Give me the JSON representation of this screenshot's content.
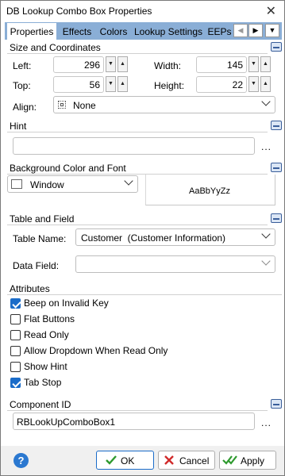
{
  "window": {
    "title": "DB Lookup Combo Box Properties",
    "close_glyph": "✕"
  },
  "tabs": [
    {
      "label": "Properties",
      "active": true
    },
    {
      "label": "Effects"
    },
    {
      "label": "Colors"
    },
    {
      "label": "Lookup Settings"
    },
    {
      "label": "EEPs"
    }
  ],
  "tab_nav": {
    "prev": "◀",
    "next": "▶",
    "menu": "▼"
  },
  "size_coords": {
    "header": "Size and Coordinates",
    "left_label": "Left:",
    "left_value": "296",
    "top_label": "Top:",
    "top_value": "56",
    "width_label": "Width:",
    "width_value": "145",
    "height_label": "Height:",
    "height_value": "22",
    "align_label": "Align:",
    "align_value": "None"
  },
  "spin": {
    "down": "▼",
    "up": "▲"
  },
  "hint": {
    "header": "Hint",
    "value": "",
    "ellipsis": "..."
  },
  "bg_font": {
    "header": "Background Color and Font",
    "color_value": "Window",
    "font_preview": "AaBbYyZz"
  },
  "table_field": {
    "header": "Table and Field",
    "table_label": "Table Name:",
    "table_value": "Customer  (Customer Information)",
    "field_label": "Data Field:",
    "field_value": ""
  },
  "attributes": {
    "header": "Attributes",
    "items": [
      {
        "label": "Beep on Invalid Key",
        "checked": true
      },
      {
        "label": "Flat Buttons",
        "checked": false
      },
      {
        "label": "Read Only",
        "checked": false
      },
      {
        "label": "Allow Dropdown When Read Only",
        "checked": false
      },
      {
        "label": "Show Hint",
        "checked": false
      },
      {
        "label": "Tab Stop",
        "checked": true
      }
    ]
  },
  "component_id": {
    "header": "Component ID",
    "value": "RBLookUpComboBox1",
    "ellipsis": "..."
  },
  "footer": {
    "help": "?",
    "ok_label": "OK",
    "cancel_label": "Cancel",
    "apply_label": "Apply"
  },
  "colors": {
    "tab_bar": "#8aaed6",
    "accent": "#1a6cc9",
    "ok_check": "#2e9a2e",
    "cancel_x": "#d12a2a"
  }
}
